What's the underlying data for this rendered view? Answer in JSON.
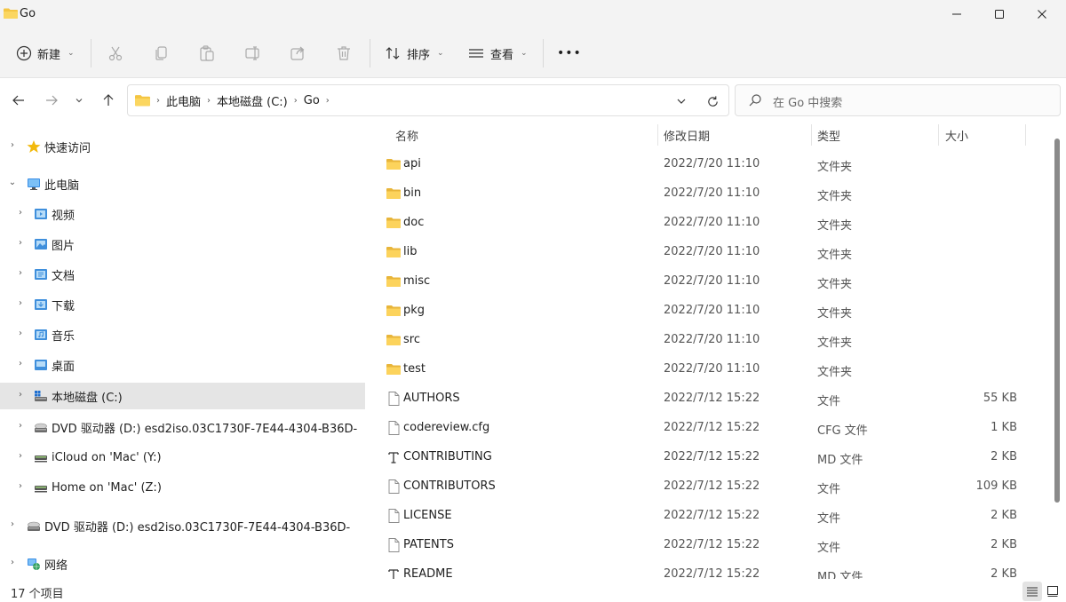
{
  "window": {
    "title": "Go"
  },
  "toolbar": {
    "new_label": "新建",
    "sort_label": "排序",
    "view_label": "查看",
    "more_label": "•••"
  },
  "address": {
    "crumbs": [
      "此电脑",
      "本地磁盘 (C:)",
      "Go"
    ]
  },
  "search": {
    "placeholder": "在 Go 中搜索"
  },
  "nav": {
    "items": [
      {
        "label": "快速访问",
        "icon": "star-icon"
      },
      {
        "label": "此电脑",
        "icon": "computer-icon"
      },
      {
        "label": "视频",
        "icon": "video-folder-icon"
      },
      {
        "label": "图片",
        "icon": "pictures-folder-icon"
      },
      {
        "label": "文档",
        "icon": "documents-folder-icon"
      },
      {
        "label": "下载",
        "icon": "downloads-folder-icon"
      },
      {
        "label": "音乐",
        "icon": "music-folder-icon"
      },
      {
        "label": "桌面",
        "icon": "desktop-folder-icon"
      },
      {
        "label": "本地磁盘 (C:)",
        "icon": "local-disk-icon"
      },
      {
        "label": "DVD 驱动器 (D:) esd2iso.03C1730F-7E44-4304-B36D-",
        "icon": "dvd-drive-icon"
      },
      {
        "label": "iCloud on 'Mac' (Y:)",
        "icon": "network-drive-icon"
      },
      {
        "label": "Home on 'Mac' (Z:)",
        "icon": "network-drive-icon"
      },
      {
        "label": "DVD 驱动器 (D:) esd2iso.03C1730F-7E44-4304-B36D-",
        "icon": "dvd-drive-icon"
      },
      {
        "label": "网络",
        "icon": "network-icon"
      }
    ]
  },
  "columns": {
    "name": "名称",
    "date": "修改日期",
    "type": "类型",
    "size": "大小"
  },
  "files": [
    {
      "name": "api",
      "date": "2022/7/20 11:10",
      "type": "文件夹",
      "size": "",
      "icon": "folder-icon"
    },
    {
      "name": "bin",
      "date": "2022/7/20 11:10",
      "type": "文件夹",
      "size": "",
      "icon": "folder-icon"
    },
    {
      "name": "doc",
      "date": "2022/7/20 11:10",
      "type": "文件夹",
      "size": "",
      "icon": "folder-icon"
    },
    {
      "name": "lib",
      "date": "2022/7/20 11:10",
      "type": "文件夹",
      "size": "",
      "icon": "folder-icon"
    },
    {
      "name": "misc",
      "date": "2022/7/20 11:10",
      "type": "文件夹",
      "size": "",
      "icon": "folder-icon"
    },
    {
      "name": "pkg",
      "date": "2022/7/20 11:10",
      "type": "文件夹",
      "size": "",
      "icon": "folder-icon"
    },
    {
      "name": "src",
      "date": "2022/7/20 11:10",
      "type": "文件夹",
      "size": "",
      "icon": "folder-icon"
    },
    {
      "name": "test",
      "date": "2022/7/20 11:10",
      "type": "文件夹",
      "size": "",
      "icon": "folder-icon"
    },
    {
      "name": "AUTHORS",
      "date": "2022/7/12 15:22",
      "type": "文件",
      "size": "55 KB",
      "icon": "file-icon"
    },
    {
      "name": "codereview.cfg",
      "date": "2022/7/12 15:22",
      "type": "CFG 文件",
      "size": "1 KB",
      "icon": "file-icon"
    },
    {
      "name": "CONTRIBUTING",
      "date": "2022/7/12 15:22",
      "type": "MD 文件",
      "size": "2 KB",
      "icon": "text-file-icon"
    },
    {
      "name": "CONTRIBUTORS",
      "date": "2022/7/12 15:22",
      "type": "文件",
      "size": "109 KB",
      "icon": "file-icon"
    },
    {
      "name": "LICENSE",
      "date": "2022/7/12 15:22",
      "type": "文件",
      "size": "2 KB",
      "icon": "file-icon"
    },
    {
      "name": "PATENTS",
      "date": "2022/7/12 15:22",
      "type": "文件",
      "size": "2 KB",
      "icon": "file-icon"
    },
    {
      "name": "README",
      "date": "2022/7/12 15:22",
      "type": "MD 文件",
      "size": "2 KB",
      "icon": "text-file-icon"
    }
  ],
  "status": {
    "count": "17 个项目"
  },
  "colors": {
    "folder": "#f4c542",
    "selected_bg": "#e5e5e5",
    "chrome_bg": "#f3f3f3"
  }
}
